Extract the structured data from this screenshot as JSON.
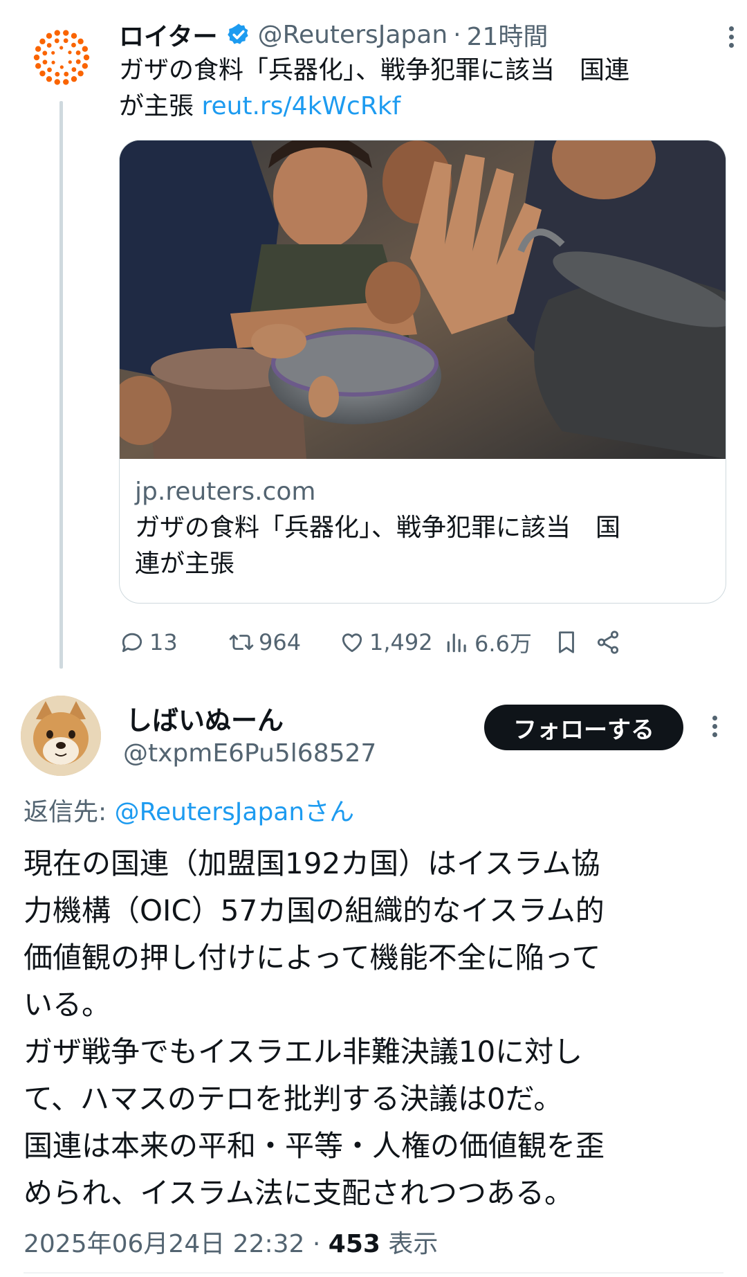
{
  "parent_tweet": {
    "author_name": "ロイター",
    "author_handle": "@ReutersJapan",
    "separator": "·",
    "time": "21時間",
    "text": "ガザの食料「兵器化」、戦争犯罪に該当　国連が主張",
    "text_line1": "ガザの食料「兵器化」、戦争犯罪に該当　国連",
    "text_line2": "が主張 ",
    "link_text": "reut.rs/4kWcRkf",
    "card": {
      "domain": "jp.reuters.com",
      "title_line1": "ガザの食料「兵器化」、戦争犯罪に該当　国",
      "title_line2": "連が主張"
    },
    "stats": {
      "replies": "13",
      "retweets": "964",
      "likes": "1,492",
      "views": "6.6万"
    }
  },
  "reply_tweet": {
    "author_name": "しばいぬーん",
    "author_handle": "@txpmE6Pu5l68527",
    "follow_label": "フォローする",
    "reply_to_prefix": "返信先: ",
    "reply_to_handle": "@ReutersJapanさん",
    "lines": [
      "現在の国連（加盟国192カ国）はイスラム協",
      "力機構（OIC）57カ国の組織的なイスラム的",
      "価値観の押し付けによって機能不全に陥って",
      "いる。",
      "ガザ戦争でもイスラエル非難決議10に対し",
      "て、ハマスのテロを批判する決議は0だ。",
      "国連は本来の平和・平等・人権の価値観を歪",
      "められ、イスラム法に支配されつつある。"
    ],
    "timestamp": "2025年06月24日 22:32",
    "separator": " · ",
    "views_count": "453",
    "views_label": " 表示"
  },
  "colors": {
    "accent": "#1d9bf0",
    "reuters_orange": "#fa6400",
    "text_primary": "#0f1419",
    "text_secondary": "#536471"
  },
  "icons": {
    "reuters_logo": "reuters-dots-logo",
    "verified": "verified-badge-icon",
    "reply": "reply-icon",
    "retweet": "retweet-icon",
    "like": "heart-icon",
    "views": "views-chart-icon",
    "bookmark": "bookmark-icon",
    "share": "share-icon",
    "more": "more-vertical-icon"
  }
}
